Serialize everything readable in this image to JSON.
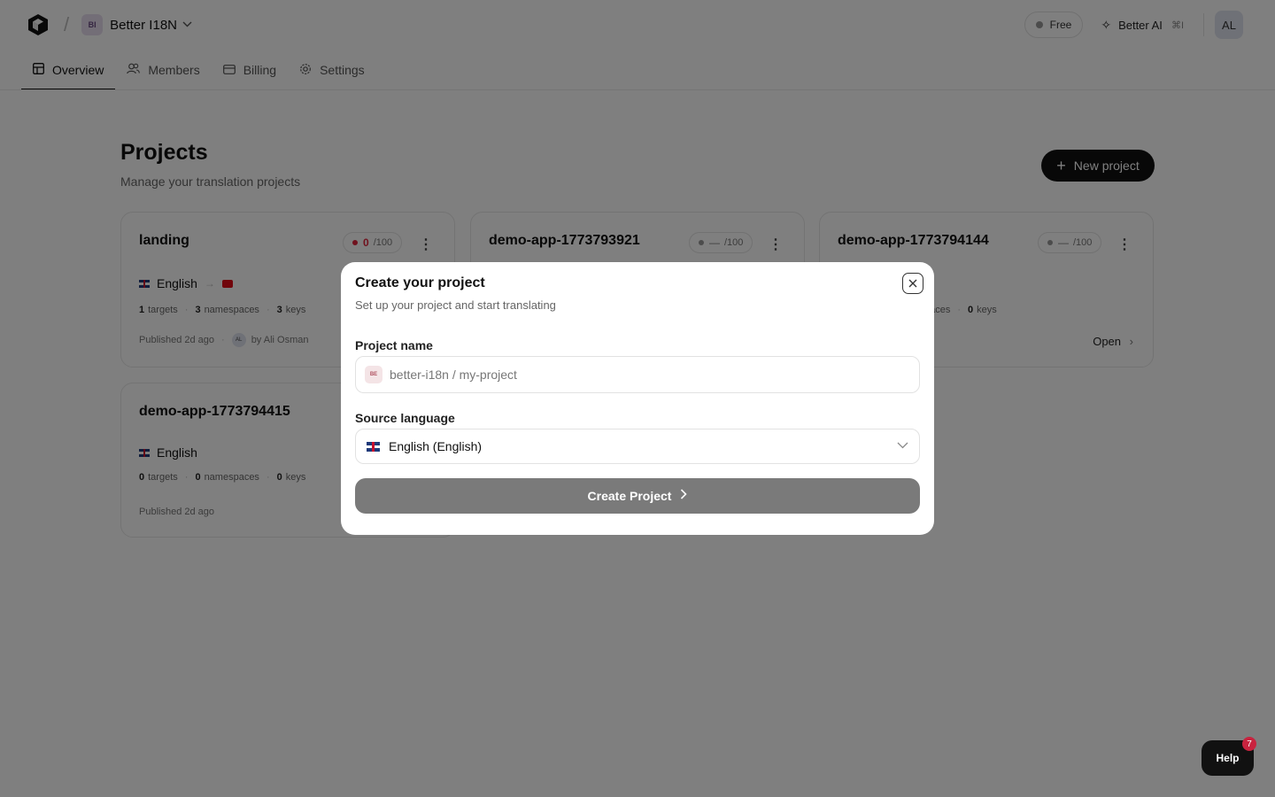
{
  "header": {
    "org_badge": "BI",
    "org_name": "Better I18N",
    "plan": "Free",
    "ai_label": "Better AI",
    "ai_shortcut": "⌘I",
    "avatar": "AL"
  },
  "tabs": [
    {
      "label": "Overview",
      "icon": "layout-icon"
    },
    {
      "label": "Members",
      "icon": "users-icon"
    },
    {
      "label": "Billing",
      "icon": "card-icon"
    },
    {
      "label": "Settings",
      "icon": "gear-icon"
    }
  ],
  "page": {
    "title": "Projects",
    "subtitle": "Manage your translation projects",
    "new_button": "New project"
  },
  "projects": [
    {
      "name": "landing",
      "score": "0",
      "score_max": "/100",
      "source_lang": "English",
      "targets": "1",
      "targets_label": "targets",
      "namespaces": "3",
      "namespaces_label": "namespaces",
      "keys": "3",
      "keys_label": "keys",
      "published": "Published 2d ago",
      "author_avatar": "AL",
      "author": "by Ali Osman"
    },
    {
      "name": "demo-app-1773793921",
      "score": "—",
      "score_max": "/100"
    },
    {
      "name": "demo-app-1773794144",
      "score": "—",
      "score_max": "/100",
      "namespaces_label_partial": "paces",
      "keys": "0",
      "keys_label": "keys",
      "open": "Open"
    },
    {
      "name": "demo-app-1773794415",
      "source_lang": "English",
      "targets": "0",
      "targets_label": "targets",
      "namespaces": "0",
      "namespaces_label": "namespaces",
      "keys": "0",
      "keys_label": "keys",
      "published": "Published 2d ago"
    }
  ],
  "modal": {
    "title": "Create your project",
    "subtitle": "Set up your project and start translating",
    "name_label": "Project name",
    "name_prefix": "BE",
    "name_placeholder": "better-i18n / my-project",
    "lang_label": "Source language",
    "lang_value": "English (English)",
    "submit": "Create Project"
  },
  "help": {
    "label": "Help",
    "badge": "7"
  }
}
